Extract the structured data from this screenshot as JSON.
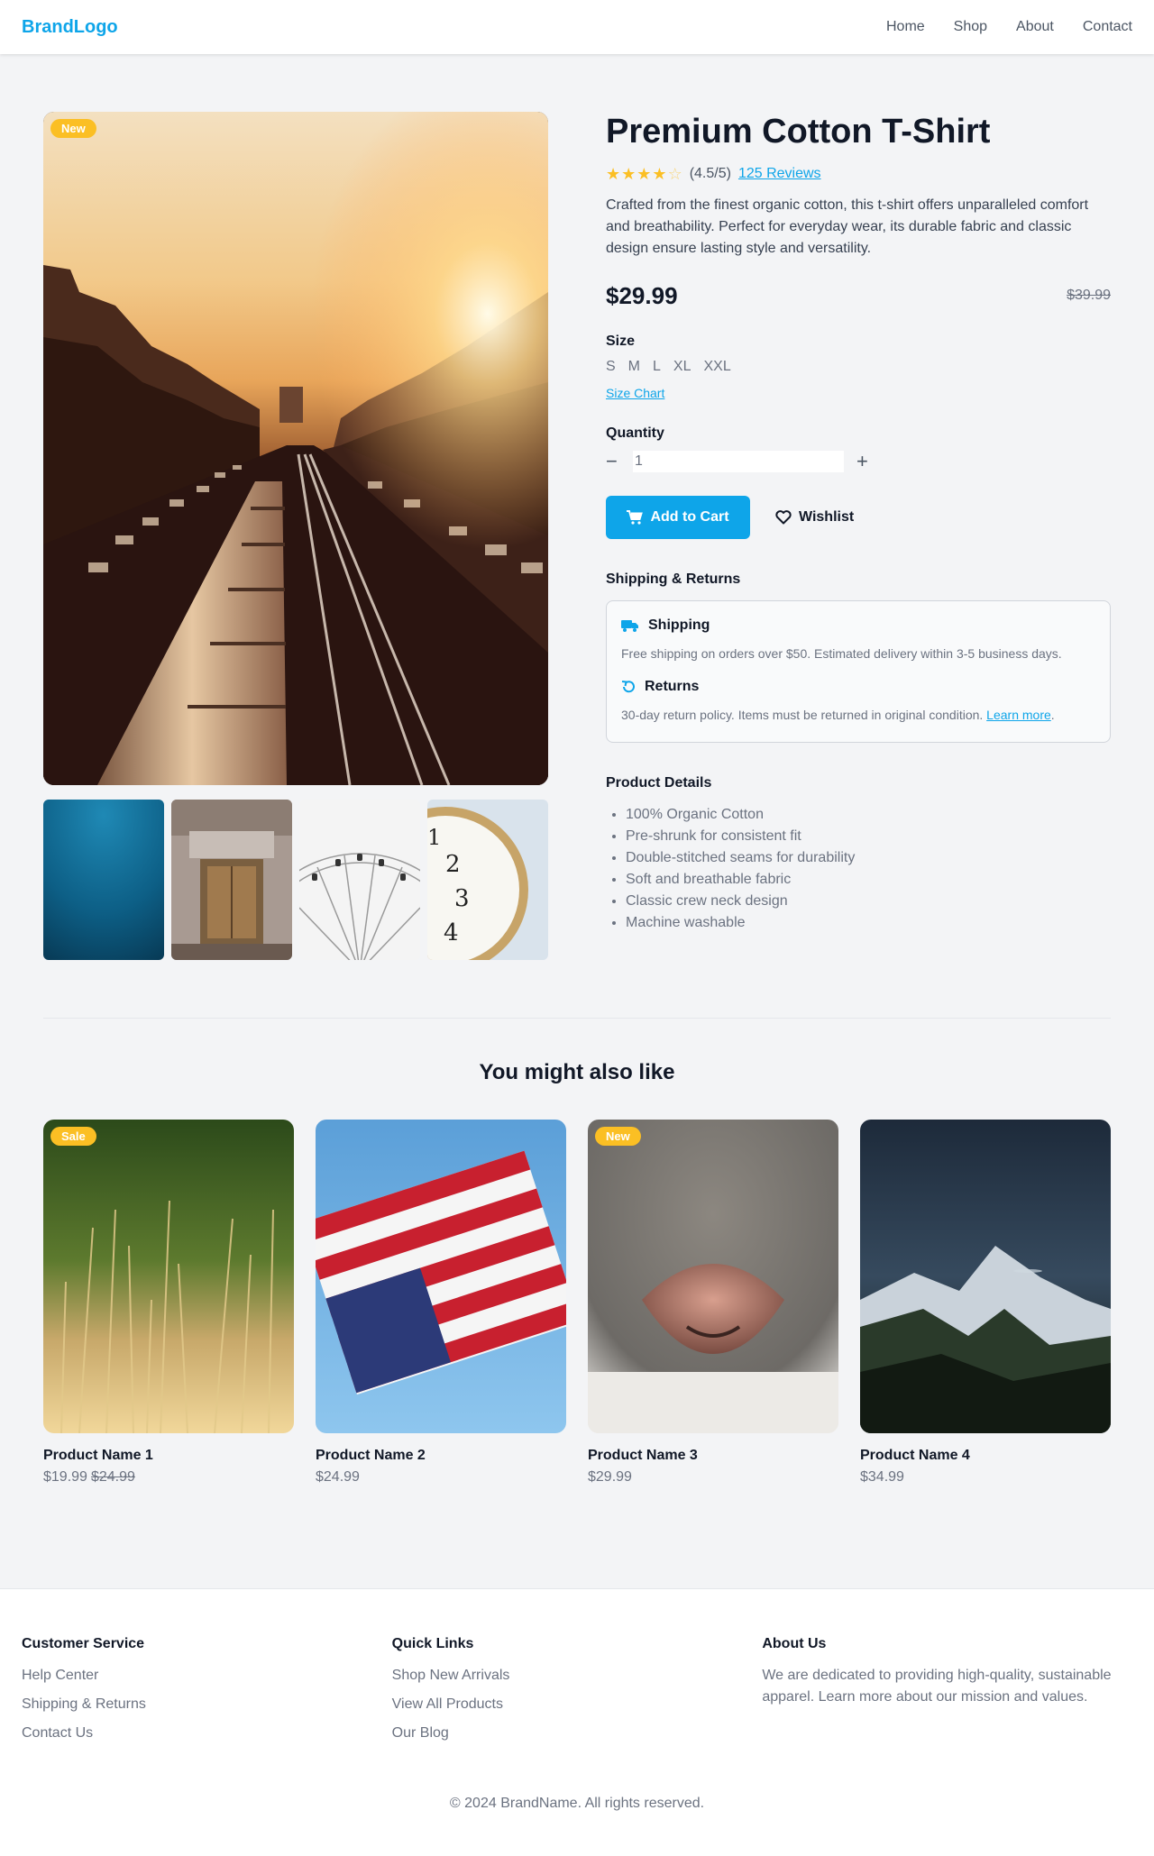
{
  "header": {
    "brand": "BrandLogo",
    "nav": [
      "Home",
      "Shop",
      "About",
      "Contact"
    ]
  },
  "product": {
    "badge": "New",
    "title": "Premium Cotton T-Shirt",
    "rating": 4.5,
    "rating_text": "(4.5/5)",
    "reviews_link": "125 Reviews",
    "description": "Crafted from the finest organic cotton, this t-shirt offers unparalleled comfort and breathability. Perfect for everyday wear, its durable fabric and classic design ensure lasting style and versatility.",
    "price": "$29.99",
    "old_price": "$39.99",
    "size_label": "Size",
    "sizes": [
      "S",
      "M",
      "L",
      "XL",
      "XXL"
    ],
    "size_chart": "Size Chart",
    "quantity_label": "Quantity",
    "quantity_value": "1",
    "add_to_cart": "Add to Cart",
    "wishlist": "Wishlist",
    "shipping_heading": "Shipping & Returns",
    "shipping_title": "Shipping",
    "shipping_text": "Free shipping on orders over $50. Estimated delivery within 3-5 business days.",
    "returns_title": "Returns",
    "returns_text": "30-day return policy. Items must be returned in original condition.",
    "learn_more": "Learn more",
    "details_heading": "Product Details",
    "details": [
      "100% Organic Cotton",
      "Pre-shrunk for consistent fit",
      "Double-stitched seams for durability",
      "Soft and breathable fabric",
      "Classic crew neck design",
      "Machine washable"
    ]
  },
  "related": {
    "title": "You might also like",
    "items": [
      {
        "name": "Product Name 1",
        "price": "$19.99",
        "old_price": "$24.99",
        "badge": "Sale"
      },
      {
        "name": "Product Name 2",
        "price": "$24.99"
      },
      {
        "name": "Product Name 3",
        "price": "$29.99",
        "badge": "New"
      },
      {
        "name": "Product Name 4",
        "price": "$34.99"
      }
    ]
  },
  "footer": {
    "customer_service": {
      "title": "Customer Service",
      "links": [
        "Help Center",
        "Shipping & Returns",
        "Contact Us"
      ]
    },
    "quick_links": {
      "title": "Quick Links",
      "links": [
        "Shop New Arrivals",
        "View All Products",
        "Our Blog"
      ]
    },
    "about": {
      "title": "About Us",
      "text": "We are dedicated to providing high-quality, sustainable apparel. Learn more about our mission and values."
    },
    "copyright": "© 2024 BrandName. All rights reserved."
  },
  "colors": {
    "accent": "#0ea5e9",
    "badge": "#fbbf24",
    "star": "#fbbf24",
    "text": "#111827",
    "muted": "#6b7280"
  },
  "icons": [
    "star-icon",
    "star-half-icon",
    "minus-icon",
    "plus-icon",
    "cart-icon",
    "heart-icon",
    "truck-icon",
    "returns-icon"
  ]
}
